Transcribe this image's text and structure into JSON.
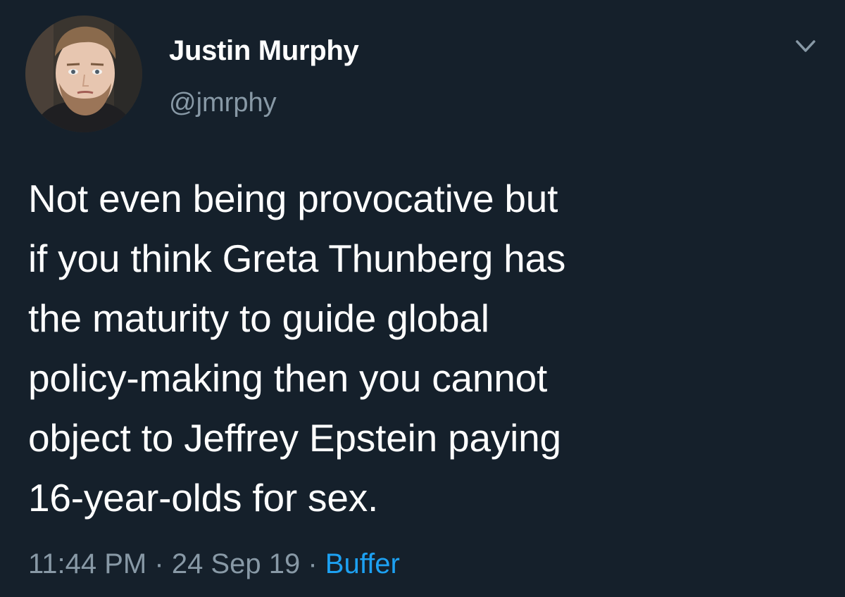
{
  "author": {
    "display_name": "Justin Murphy",
    "handle": "@jmrphy"
  },
  "icons": {
    "menu": "chevron-down-icon",
    "avatar": "profile-photo"
  },
  "tweet": {
    "text": "Not even being provocative but\nif you think Greta Thunberg has\nthe maturity to guide global\npolicy-making then you cannot\nobject to Jeffrey Epstein paying\n16-year-olds for sex."
  },
  "meta": {
    "time": "11:44 PM",
    "separator": "·",
    "date": "24 Sep 19",
    "source": "Buffer"
  },
  "colors": {
    "background": "#15202b",
    "text": "#ffffff",
    "secondary": "#8899a6",
    "link": "#1da1f2"
  }
}
